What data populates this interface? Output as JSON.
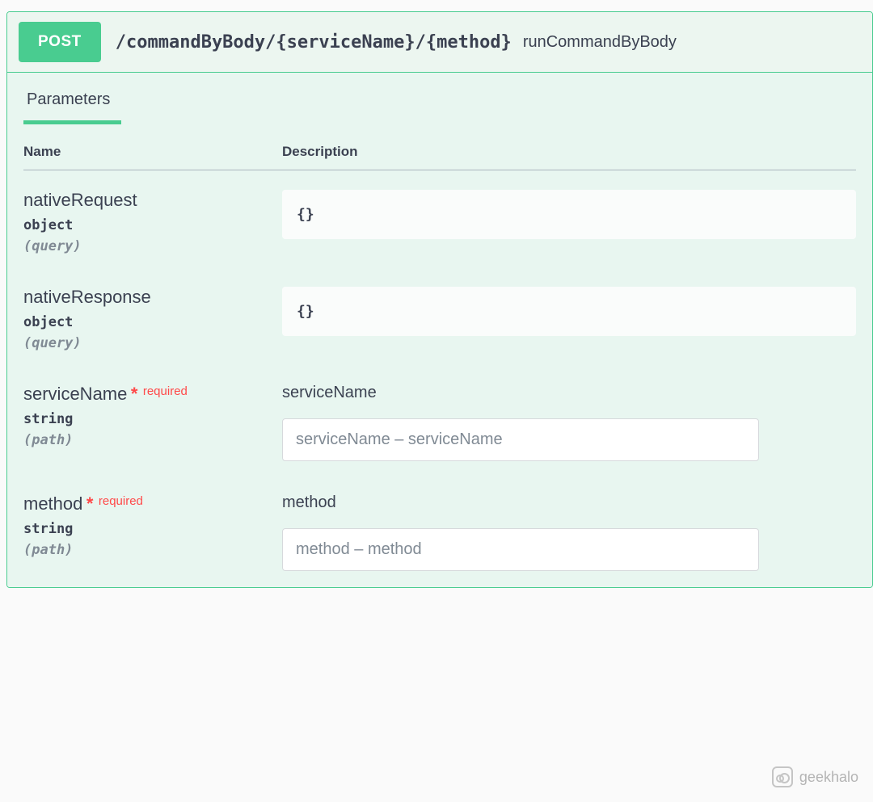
{
  "op": {
    "method": "POST",
    "path": "/commandByBody/{serviceName}/{method}",
    "summary": "runCommandByBody"
  },
  "tabs": {
    "parameters": "Parameters"
  },
  "headers": {
    "name": "Name",
    "description": "Description"
  },
  "labels": {
    "required": "required"
  },
  "params": [
    {
      "name": "nativeRequest",
      "type": "object",
      "in": "(query)",
      "required": false,
      "example": "{}"
    },
    {
      "name": "nativeResponse",
      "type": "object",
      "in": "(query)",
      "required": false,
      "example": "{}"
    },
    {
      "name": "serviceName",
      "type": "string",
      "in": "(path)",
      "required": true,
      "description": "serviceName",
      "placeholder": "serviceName – serviceName"
    },
    {
      "name": "method",
      "type": "string",
      "in": "(path)",
      "required": true,
      "description": "method",
      "placeholder": "method – method"
    }
  ],
  "watermark": "geekhalo"
}
